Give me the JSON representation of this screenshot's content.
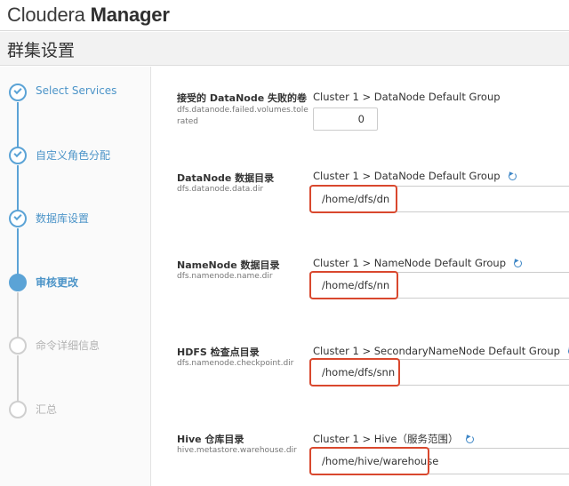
{
  "header": {
    "brand_light": "Cloudera",
    "brand_bold": "Manager"
  },
  "page": {
    "title": "群集设置"
  },
  "steps": [
    {
      "label": "Select Services",
      "state": "done"
    },
    {
      "label": "自定义角色分配",
      "state": "done"
    },
    {
      "label": "数据库设置",
      "state": "done"
    },
    {
      "label": "审核更改",
      "state": "current"
    },
    {
      "label": "命令详细信息",
      "state": "pending"
    },
    {
      "label": "汇总",
      "state": "pending"
    }
  ],
  "fields": [
    {
      "label": "接受的 DataNode 失败的卷",
      "key": "dfs.datanode.failed.volumes.tolerated",
      "group": "Cluster 1 > DataNode Default Group",
      "value": "0"
    },
    {
      "label": "DataNode 数据目录",
      "key": "dfs.datanode.data.dir",
      "group": "Cluster 1 > DataNode Default Group",
      "value": "/home/dfs/dn"
    },
    {
      "label": "NameNode 数据目录",
      "key": "dfs.namenode.name.dir",
      "group": "Cluster 1 > NameNode Default Group",
      "value": "/home/dfs/nn"
    },
    {
      "label": "HDFS 检查点目录",
      "key": "dfs.namenode.checkpoint.dir",
      "group": "Cluster 1 > SecondaryNameNode Default Group",
      "value": "/home/dfs/snn"
    },
    {
      "label": "Hive 仓库目录",
      "key": "hive.metastore.warehouse.dir",
      "group": "Cluster 1 > Hive（服务范围）",
      "value": "/home/hive/warehouse"
    }
  ],
  "colors": {
    "accent": "#5ba3d6",
    "highlight": "#d9482e"
  }
}
